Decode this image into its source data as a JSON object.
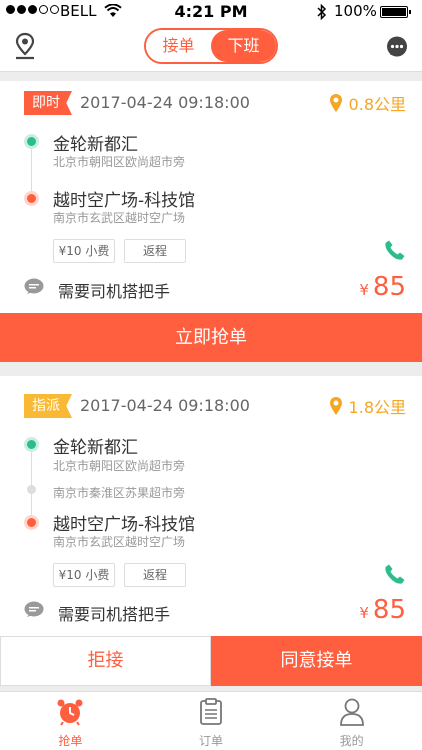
{
  "status": {
    "carrier": "BELL",
    "time": "4:21 PM",
    "battery": "100%"
  },
  "nav": {
    "seg_left": "接单",
    "seg_right": "下班"
  },
  "orders": [
    {
      "tag": "即时",
      "date": "2017-04-24 09:18:00",
      "distance": "0.8公里",
      "from_name": "金轮新都汇",
      "from_addr": "北京市朝阳区欧尚超市旁",
      "to_name": "越时空广场-科技馆",
      "to_addr": "南京市玄武区越时空广场",
      "fee": "¥10 小费",
      "return": "返程",
      "note": "需要司机搭把手",
      "currency": "¥",
      "price": "85",
      "action": "立即抢单"
    },
    {
      "tag": "指派",
      "date": "2017-04-24 09:18:00",
      "distance": "1.8公里",
      "from_name": "金轮新都汇",
      "from_addr": "北京市朝阳区欧尚超市旁",
      "via_addr": "南京市秦淮区苏果超市旁",
      "to_name": "越时空广场-科技馆",
      "to_addr": "南京市玄武区越时空广场",
      "fee": "¥10 小费",
      "return": "返程",
      "note": "需要司机搭把手",
      "currency": "¥",
      "price": "85",
      "reject": "拒接",
      "accept": "同意接单"
    }
  ],
  "tabs": [
    {
      "label": "抢单"
    },
    {
      "label": "订单"
    },
    {
      "label": "我的"
    }
  ],
  "colors": {
    "accent": "#ff5f3f",
    "green": "#2ebc8f",
    "yellow": "#f9b935"
  }
}
